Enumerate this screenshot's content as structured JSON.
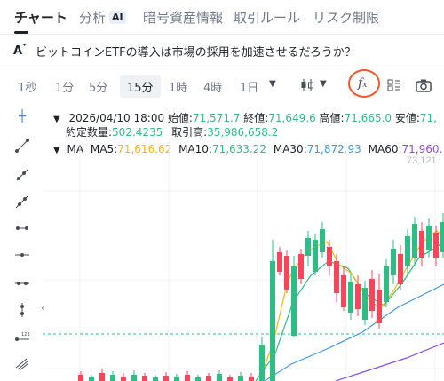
{
  "tabs": [
    {
      "label": "チャート",
      "active": true
    },
    {
      "label": "分析",
      "badge": "AI"
    },
    {
      "label": "暗号資産情報"
    },
    {
      "label": "取引ルール"
    },
    {
      "label": "リスク制限"
    }
  ],
  "banner": {
    "icon": "ai-sparkle-icon",
    "text": "ビットコインETFの導入は市場の採用を加速させるだろうか？"
  },
  "timeframes": [
    "1秒",
    "1分",
    "5分",
    "15分",
    "1時",
    "4時",
    "1日"
  ],
  "selected_timeframe": "15分",
  "toolbar_icons": [
    "chevron-down-icon",
    "candlestick-icon",
    "chevron-down-icon",
    "indicator-fx-icon",
    "layout-grid-icon",
    "camera-icon"
  ],
  "ohlc": {
    "datetime": "2026/04/10 18:00",
    "open_label": "始値:",
    "open": "71,571.7",
    "close_label": "終値:",
    "close": "71,649.6",
    "high_label": "高値:",
    "high": "71,665.0",
    "low_label": "安値:",
    "low": "71,",
    "volume_label": "約定数量:",
    "volume": "502.4235",
    "turnover_label": "取引高:",
    "turnover": "35,986,658.2"
  },
  "ma": {
    "label": "MA",
    "ma5_label": "MA5:",
    "ma5": "71,616.62",
    "ma10_label": "MA10:",
    "ma10": "71,633.22",
    "ma30_label": "MA30:",
    "ma30": "71,872.93",
    "ma60_label": "MA60:",
    "ma60": "71,960."
  },
  "price_label": "73,121.",
  "colors": {
    "up": "#2ebd85",
    "down": "#f6465d",
    "ma5": "#f0b90b",
    "ma10": "#2ebd85",
    "ma30": "#3b9be5",
    "ma60": "#8a4de0",
    "highlight_circle": "#f0582e"
  },
  "sidebar_icons": [
    "crosshair-icon",
    "trend-line-icon",
    "ray-icon",
    "extended-line-icon",
    "horizontal-line-icon",
    "horizontal-ray-icon",
    "vertical-range-icon",
    "vertical-line-icon",
    "price-line-icon",
    "fib-icon"
  ]
}
